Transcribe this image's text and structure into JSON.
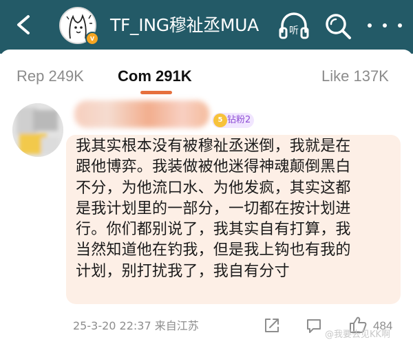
{
  "header": {
    "account_name": "TF_ING穆祉丞MUA",
    "verify_badge": "v",
    "listen_label": "听",
    "colors": {
      "background": "#235a67",
      "icon": "#ffffff"
    },
    "icons": [
      "back-icon",
      "listen-icon",
      "search-icon",
      "more-icon"
    ]
  },
  "tabs": [
    {
      "label": "Rep 249K",
      "active": false
    },
    {
      "label": "Com 291K",
      "active": true
    },
    {
      "label": "Like 137K",
      "active": false
    }
  ],
  "accent_color": "#e66f3c",
  "comment": {
    "fan_badge": "钻粉2",
    "fan_badge_level": "5",
    "lines": [
      "我其实根本没有被穆祉丞迷倒，我就是在",
      "跟他博弈。我装做被他迷得神魂颠倒黑白",
      "不分，为他流口水、为他发疯，其实这都",
      "是我计划里的一部分，一切都在按计划进",
      "行。你们都别说了，我其实自有打算，我",
      "当然知道他在钓我，但是我上钩也有我的",
      "计划，别打扰我了，我自有分寸"
    ],
    "date": "25-3-20 22:37",
    "location": "来自江苏",
    "like_count": "484",
    "bubble_color": "#fdefe6"
  },
  "watermark": "@我要去见KK啊"
}
